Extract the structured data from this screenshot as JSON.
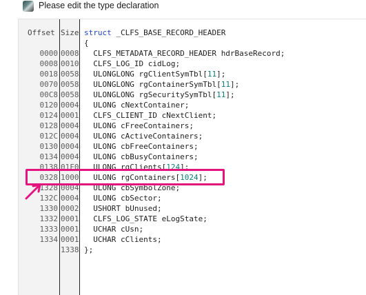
{
  "window": {
    "title": "Please edit the type declaration"
  },
  "editor": {
    "header": {
      "offset": "Offset",
      "size": "Size"
    },
    "struct_open": "struct _CLFS_BASE_RECORD_HEADER",
    "brace_open": "{",
    "brace_close": "};",
    "end_size": "1338",
    "fields": [
      {
        "offset": "0000",
        "size": "0008",
        "type": "CLFS_METADATA_RECORD_HEADER",
        "name": "hdrBaseRecord;"
      },
      {
        "offset": "0008",
        "size": "0010",
        "type": "CLFS_LOG_ID",
        "name": "cidLog;"
      },
      {
        "offset": "0018",
        "size": "0058",
        "type": "ULONGLONG",
        "name": "rgClientSymTbl[",
        "dim": "11",
        "tail": "];"
      },
      {
        "offset": "0070",
        "size": "0058",
        "type": "ULONGLONG",
        "name": "rgContainerSymTbl[",
        "dim": "11",
        "tail": "];"
      },
      {
        "offset": "00C8",
        "size": "0058",
        "type": "ULONGLONG",
        "name": "rgSecuritySymTbl[",
        "dim": "11",
        "tail": "];"
      },
      {
        "offset": "0120",
        "size": "0004",
        "type": "ULONG",
        "name": "cNextContainer;"
      },
      {
        "offset": "0124",
        "size": "0001",
        "type": "CLFS_CLIENT_ID",
        "name": "cNextClient;"
      },
      {
        "offset": "0128",
        "size": "0004",
        "type": "ULONG",
        "name": "cFreeContainers;"
      },
      {
        "offset": "012C",
        "size": "0004",
        "type": "ULONG",
        "name": "cActiveContainers;"
      },
      {
        "offset": "0130",
        "size": "0004",
        "type": "ULONG",
        "name": "cbFreeContainers;"
      },
      {
        "offset": "0134",
        "size": "0004",
        "type": "ULONG",
        "name": "cbBusyContainers;"
      },
      {
        "offset": "0138",
        "size": "01F0",
        "type": "ULONG",
        "name": "rgClients[",
        "dim": "124",
        "tail": "];"
      },
      {
        "offset": "0328",
        "size": "1000",
        "type": "ULONG",
        "name": "rgContainers[",
        "dim": "1024",
        "tail": "];"
      },
      {
        "offset": "1328",
        "size": "0004",
        "type": "ULONG",
        "name": "cbSymbolZone;"
      },
      {
        "offset": "132C",
        "size": "0004",
        "type": "ULONG",
        "name": "cbSector;"
      },
      {
        "offset": "1330",
        "size": "0002",
        "type": "USHORT",
        "name": "bUnused;"
      },
      {
        "offset": "1332",
        "size": "0001",
        "type": "CLFS_LOG_STATE",
        "name": "eLogState;"
      },
      {
        "offset": "1333",
        "size": "0001",
        "type": "UCHAR",
        "name": "cUsn;"
      },
      {
        "offset": "1334",
        "size": "0001",
        "type": "UCHAR",
        "name": "cClients;"
      }
    ],
    "highlight_color": "#e4147f"
  }
}
